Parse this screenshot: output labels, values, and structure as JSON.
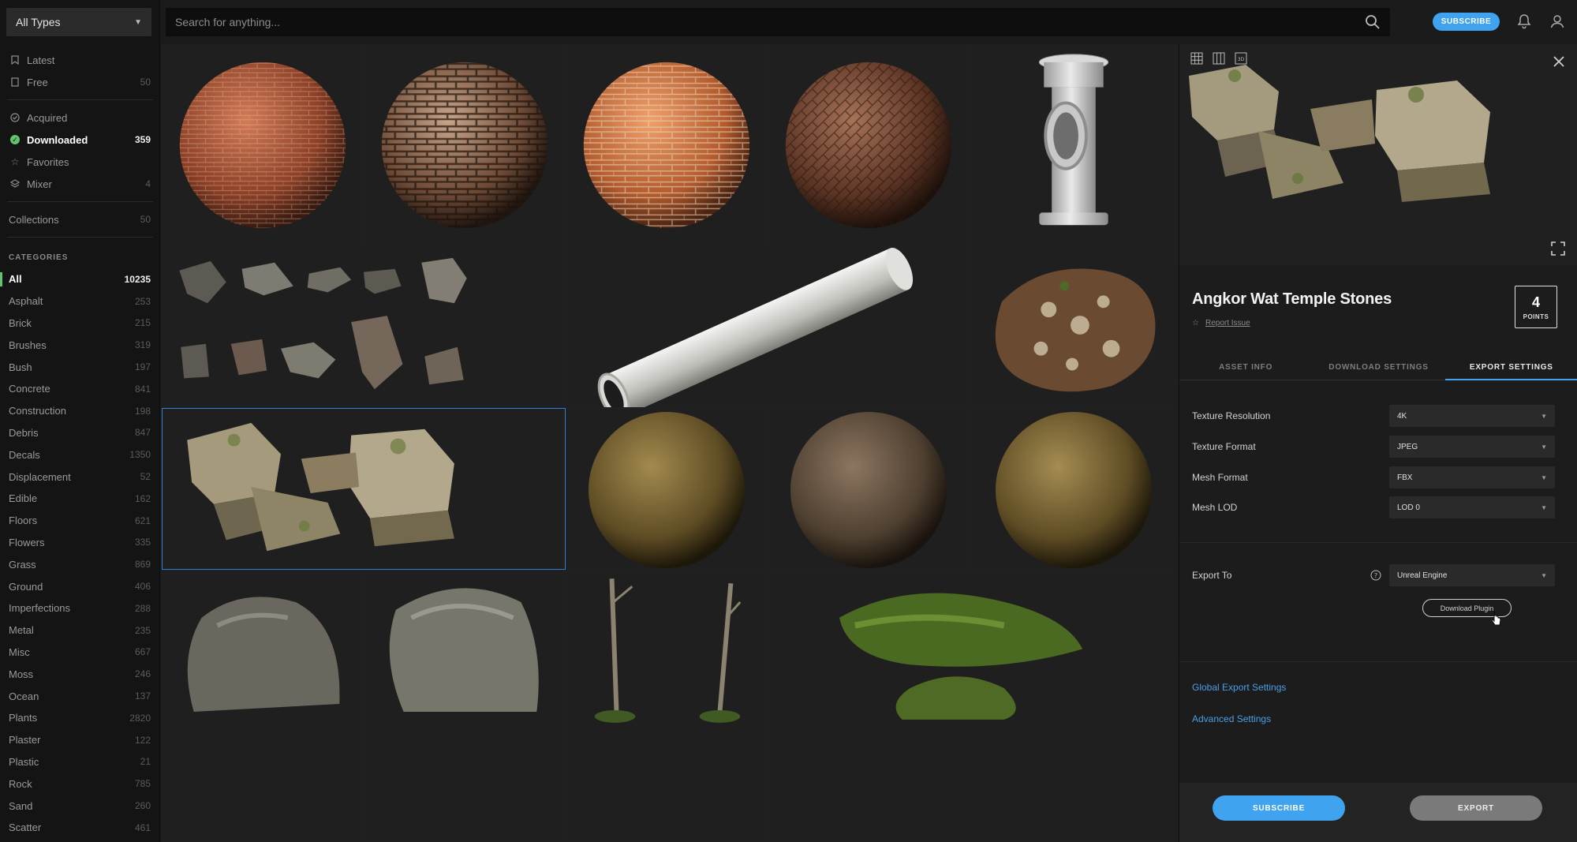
{
  "sidebar": {
    "type_select": "All Types",
    "nav": [
      {
        "label": "Latest",
        "count": "",
        "icon": "bookmark-icon"
      },
      {
        "label": "Free",
        "count": "50",
        "icon": "document-icon"
      },
      {
        "label": "Acquired",
        "count": "",
        "icon": "check-circle-icon"
      },
      {
        "label": "Downloaded",
        "count": "359",
        "icon": "check-circle-filled-icon"
      },
      {
        "label": "Favorites",
        "count": "",
        "icon": "star-icon"
      },
      {
        "label": "Mixer",
        "count": "4",
        "icon": "layers-icon"
      },
      {
        "label": "Collections",
        "count": "50",
        "icon": ""
      }
    ],
    "categories_heading": "CATEGORIES",
    "categories": [
      {
        "label": "All",
        "count": "10235"
      },
      {
        "label": "Asphalt",
        "count": "253"
      },
      {
        "label": "Brick",
        "count": "215"
      },
      {
        "label": "Brushes",
        "count": "319"
      },
      {
        "label": "Bush",
        "count": "197"
      },
      {
        "label": "Concrete",
        "count": "841"
      },
      {
        "label": "Construction",
        "count": "198"
      },
      {
        "label": "Debris",
        "count": "847"
      },
      {
        "label": "Decals",
        "count": "1350"
      },
      {
        "label": "Displacement",
        "count": "52"
      },
      {
        "label": "Edible",
        "count": "162"
      },
      {
        "label": "Floors",
        "count": "621"
      },
      {
        "label": "Flowers",
        "count": "335"
      },
      {
        "label": "Grass",
        "count": "869"
      },
      {
        "label": "Ground",
        "count": "406"
      },
      {
        "label": "Imperfections",
        "count": "288"
      },
      {
        "label": "Metal",
        "count": "235"
      },
      {
        "label": "Misc",
        "count": "667"
      },
      {
        "label": "Moss",
        "count": "246"
      },
      {
        "label": "Ocean",
        "count": "137"
      },
      {
        "label": "Plants",
        "count": "2820"
      },
      {
        "label": "Plaster",
        "count": "122"
      },
      {
        "label": "Plastic",
        "count": "21"
      },
      {
        "label": "Rock",
        "count": "785"
      },
      {
        "label": "Sand",
        "count": "260"
      },
      {
        "label": "Scatter",
        "count": "461"
      }
    ]
  },
  "topbar": {
    "search_placeholder": "Search for anything...",
    "subscribe_label": "SUBSCRIBE"
  },
  "panel": {
    "title": "Angkor Wat Temple Stones",
    "report_label": "Report Issue",
    "points_value": "4",
    "points_label": "POINTS",
    "tabs": [
      "ASSET INFO",
      "DOWNLOAD SETTINGS",
      "EXPORT SETTINGS"
    ],
    "settings": [
      {
        "label": "Texture Resolution",
        "value": "4K"
      },
      {
        "label": "Texture Format",
        "value": "JPEG"
      },
      {
        "label": "Mesh Format",
        "value": "FBX"
      },
      {
        "label": "Mesh LOD",
        "value": "LOD 0"
      }
    ],
    "export_to_label": "Export To",
    "export_to_value": "Unreal Engine",
    "download_plugin_label": "Download Plugin",
    "global_settings_link": "Global Export Settings",
    "advanced_settings_link": "Advanced Settings",
    "subscribe_button": "SUBSCRIBE",
    "export_button": "EXPORT"
  },
  "colors": {
    "accent_blue": "#3fa3ef",
    "active_green": "#63c46f",
    "selection_border": "#2d7fd1"
  }
}
